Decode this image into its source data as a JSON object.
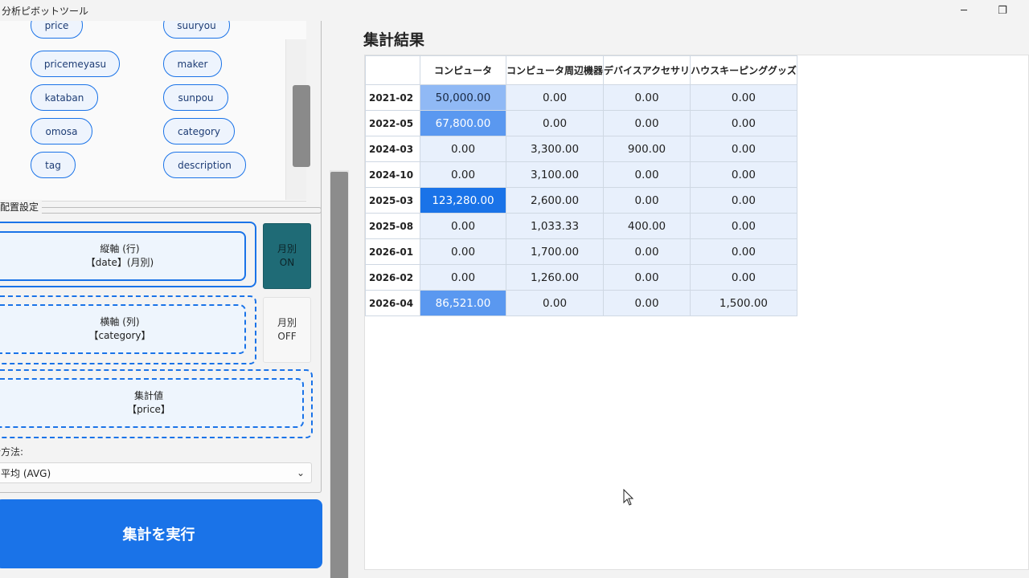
{
  "window": {
    "title": "分析ピボットツール",
    "minimize_icon": "─",
    "restore_icon": "❐"
  },
  "fields": {
    "items": [
      {
        "label": "price"
      },
      {
        "label": "suuryou"
      },
      {
        "label": "pricemeyasu"
      },
      {
        "label": "maker"
      },
      {
        "label": "kataban"
      },
      {
        "label": "sunpou"
      },
      {
        "label": "omosa"
      },
      {
        "label": "category"
      },
      {
        "label": "tag"
      },
      {
        "label": "description"
      }
    ]
  },
  "layout_settings": {
    "legend": "配置設定",
    "rows": {
      "title": "縦軸 (行)",
      "value": "【date】(月別)",
      "monthly_toggle": [
        "月別",
        "ON"
      ]
    },
    "cols": {
      "title": "横軸 (列)",
      "value": "【category】",
      "monthly_toggle": [
        "月別",
        "OFF"
      ]
    },
    "values": {
      "title": "集計値",
      "value": "【price】"
    },
    "method_label": "集計方法:",
    "method_selected": "平均 (AVG)",
    "method_chevron": "⌄"
  },
  "run_button": "集計を実行",
  "result": {
    "title": "集計結果",
    "columns": [
      "",
      "コンピュータ",
      "コンピュータ周辺機器",
      "デバイスアクセサリ",
      "ハウスキーピンググッズ"
    ],
    "rows": [
      {
        "label": "2021-02",
        "values": [
          "50,000.00",
          "0.00",
          "0.00",
          "0.00"
        ],
        "levels": [
          "mid",
          "",
          "",
          ""
        ]
      },
      {
        "label": "2022-05",
        "values": [
          "67,800.00",
          "0.00",
          "0.00",
          "0.00"
        ],
        "levels": [
          "midhi",
          "",
          "",
          ""
        ]
      },
      {
        "label": "2024-03",
        "values": [
          "0.00",
          "3,300.00",
          "900.00",
          "0.00"
        ],
        "levels": [
          "",
          "",
          "",
          ""
        ]
      },
      {
        "label": "2024-10",
        "values": [
          "0.00",
          "3,100.00",
          "0.00",
          "0.00"
        ],
        "levels": [
          "",
          "",
          "",
          ""
        ]
      },
      {
        "label": "2025-03",
        "values": [
          "123,280.00",
          "2,600.00",
          "0.00",
          "0.00"
        ],
        "levels": [
          "hi",
          "",
          "",
          ""
        ]
      },
      {
        "label": "2025-08",
        "values": [
          "0.00",
          "1,033.33",
          "400.00",
          "0.00"
        ],
        "levels": [
          "",
          "",
          "",
          ""
        ]
      },
      {
        "label": "2026-01",
        "values": [
          "0.00",
          "1,700.00",
          "0.00",
          "0.00"
        ],
        "levels": [
          "",
          "",
          "",
          ""
        ]
      },
      {
        "label": "2026-02",
        "values": [
          "0.00",
          "1,260.00",
          "0.00",
          "0.00"
        ],
        "levels": [
          "",
          "",
          "",
          ""
        ]
      },
      {
        "label": "2026-04",
        "values": [
          "86,521.00",
          "0.00",
          "0.00",
          "1,500.00"
        ],
        "levels": [
          "midhi",
          "",
          "",
          ""
        ]
      }
    ]
  },
  "colors": {
    "accent": "#1a73e8",
    "toggle_on": "#1f6b76",
    "cell_base": "#e8f0fc"
  }
}
